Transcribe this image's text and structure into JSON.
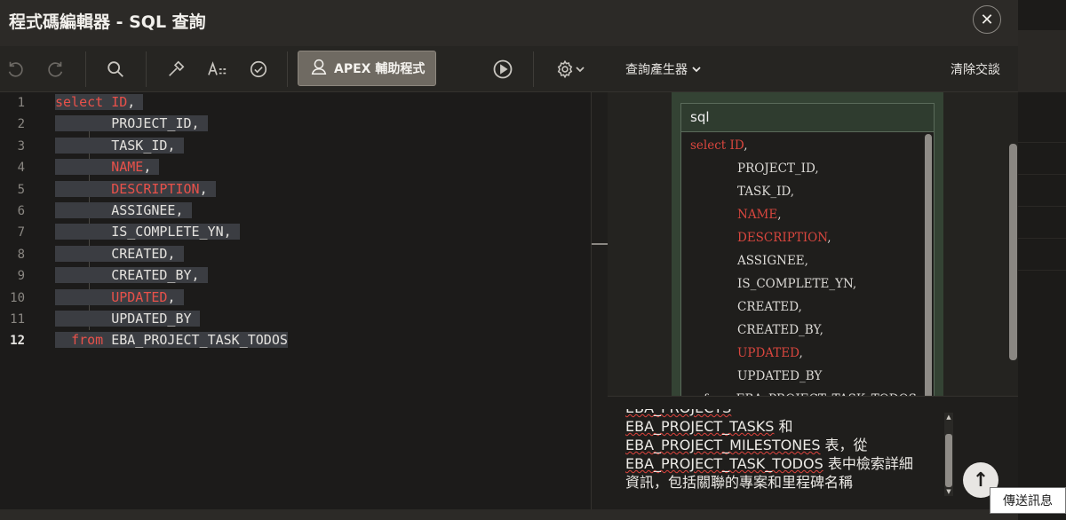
{
  "dialog": {
    "title": "程式碼編輯器 - SQL 查詢",
    "close_symbol": "✕"
  },
  "toolbar": {
    "apex_assistant_label": "APEX 輔助程式",
    "icons": [
      "undo-icon",
      "redo-icon",
      "search-icon",
      "hammer-icon",
      "text-format-icon",
      "validate-icon",
      "run-icon",
      "gear-icon",
      "chevron-down-icon"
    ]
  },
  "editor": {
    "line_numbers": [
      "1",
      "2",
      "3",
      "4",
      "5",
      "6",
      "7",
      "8",
      "9",
      "10",
      "11",
      "12"
    ],
    "lines": [
      {
        "keyword": "select",
        "ident": "ID",
        "punct": ",",
        "red": true
      },
      {
        "keyword": "",
        "ident": "PROJECT_ID",
        "punct": ",",
        "red": false
      },
      {
        "keyword": "",
        "ident": "TASK_ID",
        "punct": ",",
        "red": false
      },
      {
        "keyword": "",
        "ident": "NAME",
        "punct": ",",
        "red": true
      },
      {
        "keyword": "",
        "ident": "DESCRIPTION",
        "punct": ",",
        "red": true
      },
      {
        "keyword": "",
        "ident": "ASSIGNEE",
        "punct": ",",
        "red": false
      },
      {
        "keyword": "",
        "ident": "IS_COMPLETE_YN",
        "punct": ",",
        "red": false
      },
      {
        "keyword": "",
        "ident": "CREATED",
        "punct": ",",
        "red": false
      },
      {
        "keyword": "",
        "ident": "CREATED_BY",
        "punct": ",",
        "red": false
      },
      {
        "keyword": "",
        "ident": "UPDATED",
        "punct": ",",
        "red": true
      },
      {
        "keyword": "",
        "ident": "UPDATED_BY",
        "punct": "",
        "red": false
      },
      {
        "keyword": "from",
        "ident": "EBA_PROJECT_TASK_TODOS",
        "punct": "",
        "red": false
      }
    ]
  },
  "right_panel": {
    "query_builder_label": "查詢產生器",
    "clear_conversation_label": "清除交談",
    "sql_card": {
      "header": "sql",
      "l1_kw": "select",
      "l1_id": "ID",
      "l2": "PROJECT_ID,",
      "l3": "TASK_ID,",
      "l4": "NAME",
      "l5": "DESCRIPTION",
      "l6": "ASSIGNEE,",
      "l7": "IS_COMPLETE_YN,",
      "l8": "CREATED,",
      "l9": "CREATED_BY,",
      "l10": "UPDATED",
      "l11": "UPDATED_BY",
      "l12": "from EBA_PROJECT_TASK_TODOS"
    },
    "message": {
      "line0": "EBA_PROJECTS",
      "line1_a": "EBA_PROJECT_TASKS",
      "line1_b": " 和",
      "line2_a": "EBA_PROJECT_MILESTONES",
      "line2_b": " 表，從",
      "line3_a": "EBA_PROJECT_TASK_TODOS",
      "line3_b": " 表中檢索詳細",
      "line4": "資訊，包括關聯的專案和里程碑名稱"
    },
    "send_symbol": "↑"
  },
  "tooltip": {
    "label": "傳送訊息"
  }
}
